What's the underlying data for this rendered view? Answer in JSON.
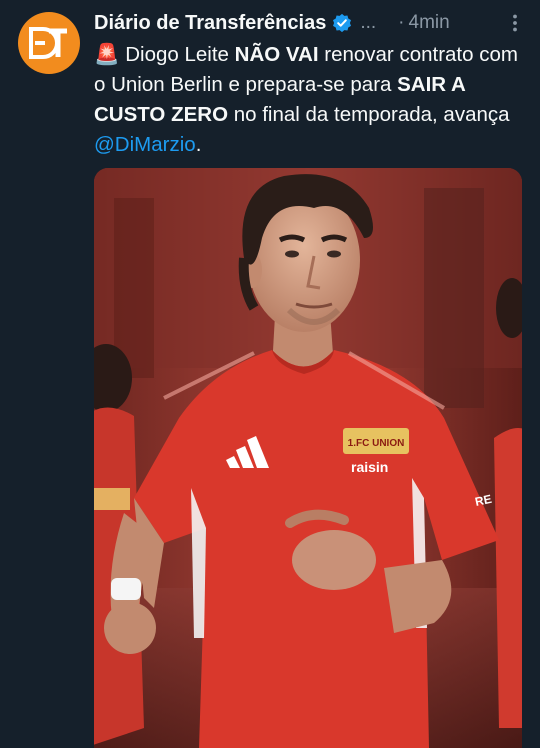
{
  "tweet": {
    "account_name": "Diário de Transferências",
    "handle_truncated": "...",
    "separator": "·",
    "time": "4min",
    "text": {
      "siren": "🚨",
      "part1": " Diogo Leite ",
      "bold1": "NÃO VAI",
      "part2": " renovar contrato com o Union Berlin e prepara-se para ",
      "bold2": "SAIR A CUSTO ZERO",
      "part3": " no final da temporada, avança ",
      "mention": "@DiMarzio",
      "part4": "."
    },
    "avatar_initials": "DT",
    "shirt_badge_text": "1.FC UNION",
    "shirt_sponsor_text": "raisin",
    "sleeve_text": "RE"
  },
  "colors": {
    "background": "#15202b",
    "avatar": "#f28c1e",
    "mention": "#1d9bf0",
    "verified": "#1d9bf0",
    "muted": "#8b98a5",
    "shirt_red": "#d9382c"
  },
  "icons": [
    "avatar-logo-icon",
    "verified-badge-icon",
    "more-options-icon",
    "siren-icon"
  ]
}
